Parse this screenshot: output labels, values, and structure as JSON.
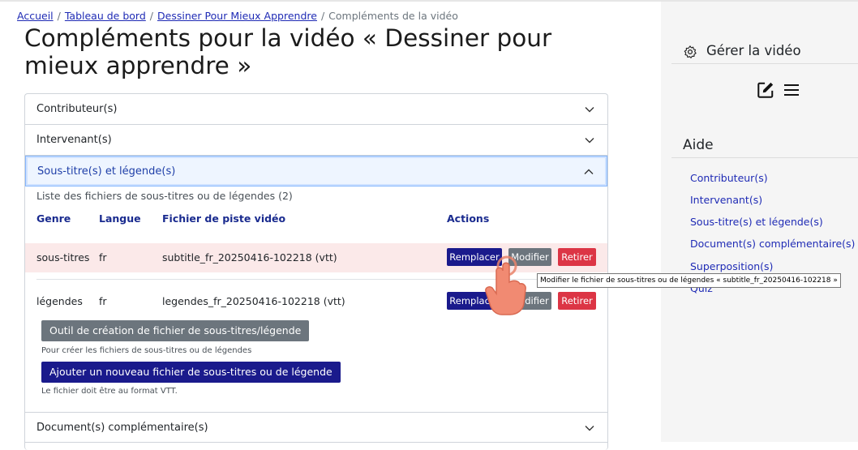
{
  "breadcrumb": {
    "items": [
      "Accueil",
      "Tableau de bord",
      "Dessiner Pour Mieux Apprendre"
    ],
    "current": "Compléments de la vidéo"
  },
  "page_title": "Compléments pour la vidéo « Dessiner pour mieux apprendre »",
  "accordion": {
    "contributors": "Contributeur(s)",
    "speakers": "Intervenant(s)",
    "subtitles": "Sous-titre(s) et légende(s)",
    "documents": "Document(s) complémentaire(s)"
  },
  "subtitles_panel": {
    "caption": "Liste des fichiers de sous-titres ou de légendes (2)",
    "headers": {
      "genre": "Genre",
      "lang": "Langue",
      "file": "Fichier de piste vidéo",
      "actions": "Actions"
    },
    "rows": [
      {
        "genre": "sous-titres",
        "lang": "fr",
        "file": "subtitle_fr_20250416-102218 (vtt)"
      },
      {
        "genre": "légendes",
        "lang": "fr",
        "file": "legendes_fr_20250416-102218 (vtt)"
      }
    ],
    "btn_replace": "Remplacer",
    "btn_edit": "Modifier",
    "btn_remove": "Retirer",
    "tool_button": "Outil de création de fichier de sous-titres/légende",
    "tool_note": "Pour créer les fichiers de sous-titres ou de légendes",
    "add_button": "Ajouter un nouveau fichier de sous-titres ou de légende",
    "add_note": "Le fichier doit être au format VTT."
  },
  "tooltip": "Modifier le fichier de sous-titres ou de légendes « subtitle_fr_20250416-102218 »",
  "side": {
    "manage_title": "Gérer la vidéo",
    "help_title": "Aide",
    "help_links": [
      "Contributeur(s)",
      "Intervenant(s)",
      "Sous-titre(s) et légende(s)",
      "Document(s) complémentaire(s)",
      "Superposition(s)",
      "Quiz"
    ]
  },
  "colors": {
    "primary": "#1a1a8c",
    "secondary": "#6c757d",
    "danger": "#dc3545",
    "link": "#1f2bb5"
  },
  "icons": [
    "gear-icon",
    "edit-icon",
    "menu-icon",
    "chevron-down-icon",
    "chevron-up-icon",
    "hand-cursor-icon"
  ]
}
